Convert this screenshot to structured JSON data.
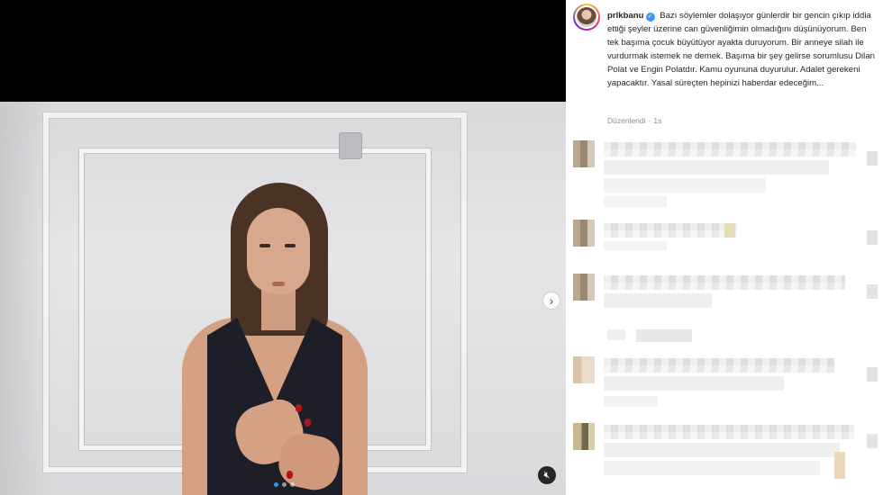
{
  "post": {
    "username": "prlkbanu",
    "verified": true,
    "caption": "Bazı söylemler dolaşıyor günlerdir bir gencin çıkıp iddia ettiği şeyler üzerine can güvenliğimin olmadığını düşünüyorum. Ben tek başıma çocuk büyütüyor ayakta duruyorum. Bir anneye silah ile vurdurmak istemek ne demek. Başıma bir şey gelirse sorumlusu Dilan Polat ve Engin Polatdır. Kamu oyununa duyurulur. Adalet gerekeni yapacaktır. Yasal süreçten hepinizi haberdar edeceğim...",
    "edited_label": "Düzenlendi",
    "separator": "·",
    "time_ago": "1s"
  },
  "media": {
    "carousel_count": 3,
    "active_index": 1,
    "next_icon": "chevron-right-icon",
    "mute_icon": "speaker-muted-icon"
  },
  "comments": {
    "count_visible": 6,
    "blurred": true
  },
  "colors": {
    "verified_blue": "#3897f0",
    "text": "#262626",
    "meta": "#8e8e8e"
  }
}
